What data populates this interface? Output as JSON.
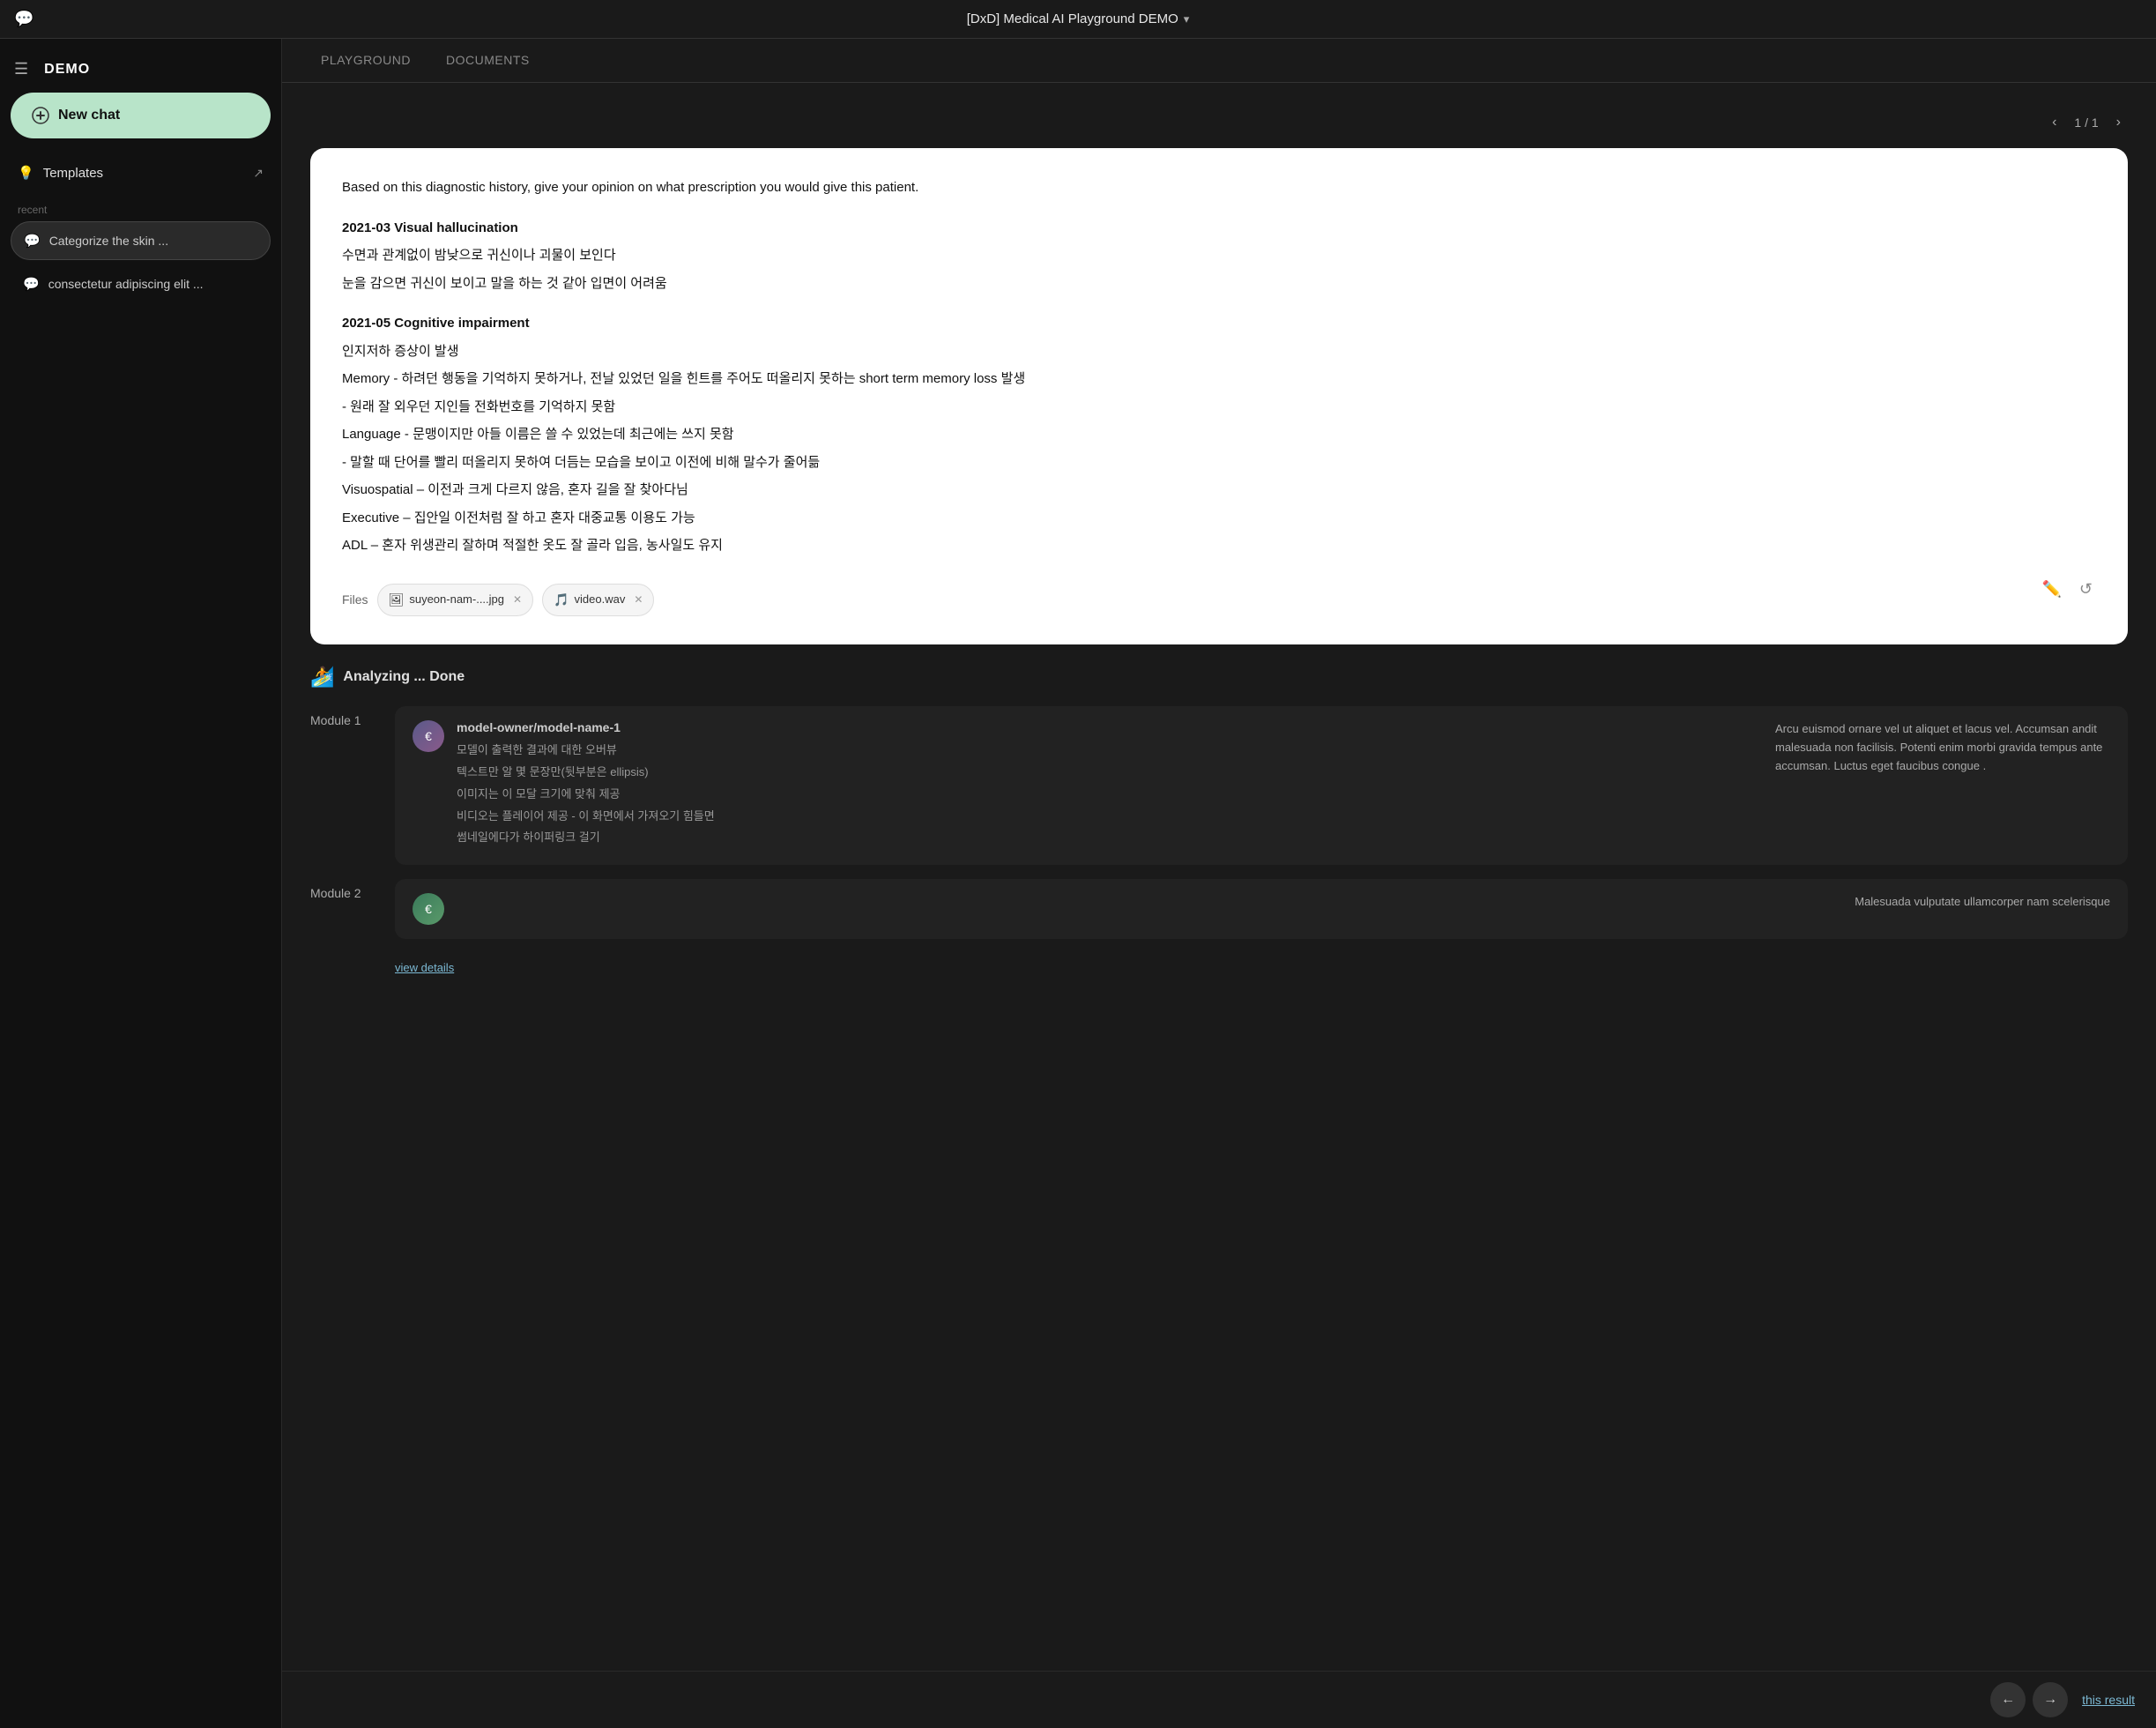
{
  "topbar": {
    "title": "[DxD] Medical AI Playground DEMO",
    "chevron": "▾"
  },
  "sidebar": {
    "logo": "DEMO",
    "new_chat_label": "New chat",
    "templates_label": "Templates",
    "recent_label": "recent",
    "chat_items": [
      {
        "label": "Categorize the skin ..."
      },
      {
        "label": "consectetur adipiscing elit ..."
      }
    ]
  },
  "tabs": [
    {
      "label": "PLAYGROUND",
      "active": false
    },
    {
      "label": "DOCUMENTS",
      "active": false
    }
  ],
  "pagination": {
    "current": "1",
    "total": "1"
  },
  "message": {
    "intro": "Based on this diagnostic history, give your opinion on what prescription you would give this patient.",
    "sections": [
      {
        "title": "2021-03 Visual hallucination",
        "lines": [
          "수면과 관계없이 밤낮으로 귀신이나 괴물이 보인다",
          "눈을 감으면 귀신이 보이고 말을 하는 것 같아 입면이 어려움"
        ]
      },
      {
        "title": "2021-05 Cognitive impairment",
        "lines": [
          "인지저하 증상이 발생",
          "Memory - 하려던 행동을 기억하지 못하거나, 전날 있었던 일을 힌트를 주어도 떠올리지 못하는 short term memory loss 발생",
          "- 원래 잘 외우던 지인들 전화번호를 기억하지 못함",
          "Language - 문맹이지만 아들 이름은 쓸 수 있었는데 최근에는 쓰지 못함",
          "- 말할 때 단어를 빨리 떠올리지 못하여 더듬는 모습을 보이고 이전에 비해 말수가 줄어듦",
          "Visuospatial – 이전과 크게 다르지 않음, 혼자 길을 잘 찾아다님",
          "Executive – 집안일 이전처럼 잘 하고 혼자 대중교통 이용도 가능",
          "ADL – 혼자 위생관리 잘하며 적절한 옷도 잘 골라 입음, 농사일도 유지"
        ]
      }
    ],
    "files_label": "Files",
    "files": [
      {
        "name": "suyeon-nam-....jpg",
        "type": "img"
      },
      {
        "name": "video.wav",
        "type": "wav"
      }
    ]
  },
  "analyzing": {
    "status": "Analyzing ... Done",
    "icon": "🏄"
  },
  "modules": [
    {
      "label": "Module 1",
      "model_name": "model-owner/model-name-1",
      "avatar_color": "#5a5a8a",
      "desc_lines": [
        "모델이 출력한 결과에 대한 오버뷰",
        "텍스트만 알 몇 문장만(뒷부분은 ellipsis)",
        "이미지는 이 모달 크기에 맞춰 제공",
        "비디오는 플레이어 제공 - 이 화면에서 가져오기 힘들면",
        "썸네일에다가 하이퍼링크 걸기"
      ],
      "right_text": "Arcu euismod ornare vel ut aliquet et lacus vel. Accumsan andit malesuada non facilisis. Potenti enim morbi gravida tempus ante accumsan. Luctus eget faucibus congue ."
    },
    {
      "label": "Module 2",
      "model_name": "",
      "avatar_color": "#3a8a5a",
      "desc_lines": [],
      "right_text": "Malesuada vulputate ullamcorper nam scelerisque"
    }
  ],
  "view_details": "view details",
  "bottom_nav": {
    "prev_icon": "←",
    "next_icon": "→",
    "result_text": "this result"
  }
}
